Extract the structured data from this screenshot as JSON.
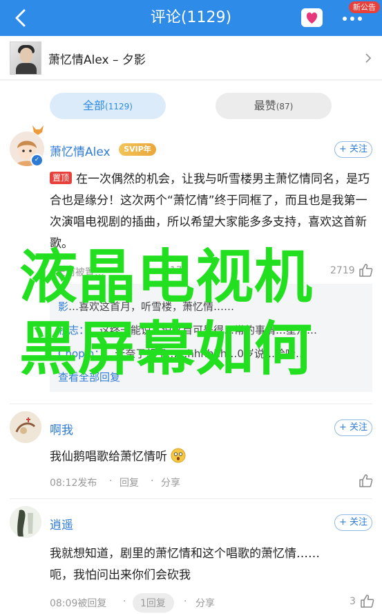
{
  "header": {
    "title": "评论(1129)",
    "notice_badge": "新公告",
    "back_icon": "chevron-left-icon",
    "heart_icon": "heart-icon",
    "more_icon": "more-dots-icon"
  },
  "song": {
    "title": "萧忆情Alex – 夕影"
  },
  "tabs": [
    {
      "label": "全部",
      "count": "(1129)",
      "selected": true
    },
    {
      "label": "最赞",
      "count": "(87)",
      "selected": false
    }
  ],
  "comments": [
    {
      "username": "萧忆情Alex",
      "vip_badge": "SVIP年",
      "follow_label": "+ 关注",
      "pin_label": "置顶",
      "text": "在一次偶然的机会，让我与听雪楼男主萧忆情同名，是巧合也是缘分！这次两个“萧忆情”终于同框了，而且也是我第一次演唱电视剧的插曲，所以希望大家能多多支持，喜欢这首新歌。",
      "meta_left": "4天前被置…",
      "meta_mid": "17",
      "like_count": "2719",
      "replies": [
        {
          "name": "影",
          "text": "…喜欢这首月，听雪楼，萧忆情……"
        },
        {
          "name": "秒志：",
          "text": "…这终于能说，说这首可是得…常的事情…星浩…"
        },
        {
          "name": "Chopin：",
          "text": "…无奈了想了……hhhhhh…0岁说…哈哈…"
        }
      ],
      "view_all": "查看全部回复"
    },
    {
      "username": "啊我",
      "follow_label": "+ 关注",
      "text": "我仙鹅唱歌给萧忆情听",
      "meta_time": "08:12发布",
      "reply_label": "回复",
      "share_label": "分享",
      "like_count": ""
    },
    {
      "username": "逍遥",
      "follow_label": "+ 关注",
      "text_line1": "我就想知道，剧里的萧忆情和这个唱歌的萧忆情……",
      "text_line2": "呃，我怕问出来你们会砍我",
      "meta_time": "08:09被回复",
      "reply_label": "1回复",
      "share_label": "分享",
      "like_count": "3"
    }
  ],
  "watermark": {
    "line1": "液晶电视机",
    "line2": "黑屏幕如何"
  },
  "colors": {
    "header_blue": "#2e8be8",
    "link_blue": "#2e7bd6",
    "pin_red": "#e8413b",
    "watermark_green": "#22e01f"
  }
}
